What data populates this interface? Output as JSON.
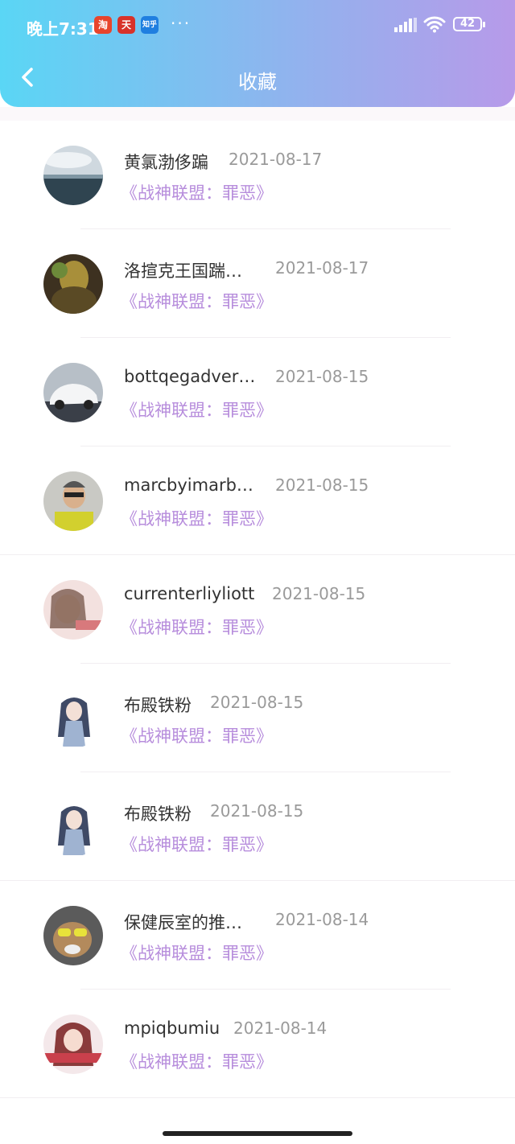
{
  "status_bar": {
    "time": "晚上7:31",
    "more": "···",
    "battery": "42"
  },
  "status_icons": [
    "淘",
    "天",
    "知乎"
  ],
  "header": {
    "title": "收藏",
    "back_icon": "chevron-left-icon"
  },
  "favorites": [
    {
      "name": "黄氯渤侈蹁",
      "date": "2021-08-17",
      "work": "《战神联盟：罪恶》"
    },
    {
      "name": "洛揎克王国踹…",
      "date": "2021-08-17",
      "work": "《战神联盟：罪恶》"
    },
    {
      "name": "bottqegadver…",
      "date": "2021-08-15",
      "work": "《战神联盟：罪恶》"
    },
    {
      "name": "marcbyimarb…",
      "date": "2021-08-15",
      "work": "《战神联盟：罪恶》"
    },
    {
      "name": "currenterliyliott",
      "date": "2021-08-15",
      "work": "《战神联盟：罪恶》"
    },
    {
      "name": "布殿铁粉",
      "date": "2021-08-15",
      "work": "《战神联盟：罪恶》"
    },
    {
      "name": "布殿铁粉",
      "date": "2021-08-15",
      "work": "《战神联盟：罪恶》"
    },
    {
      "name": "保健辰室的推…",
      "date": "2021-08-14",
      "work": "《战神联盟：罪恶》"
    },
    {
      "name": "mpiqbumiu",
      "date": "2021-08-14",
      "work": "《战神联盟：罪恶》"
    }
  ],
  "colors": {
    "header_start": "#5ad6f5",
    "header_end": "#b79ae9",
    "work_title": "#b78ddc"
  }
}
